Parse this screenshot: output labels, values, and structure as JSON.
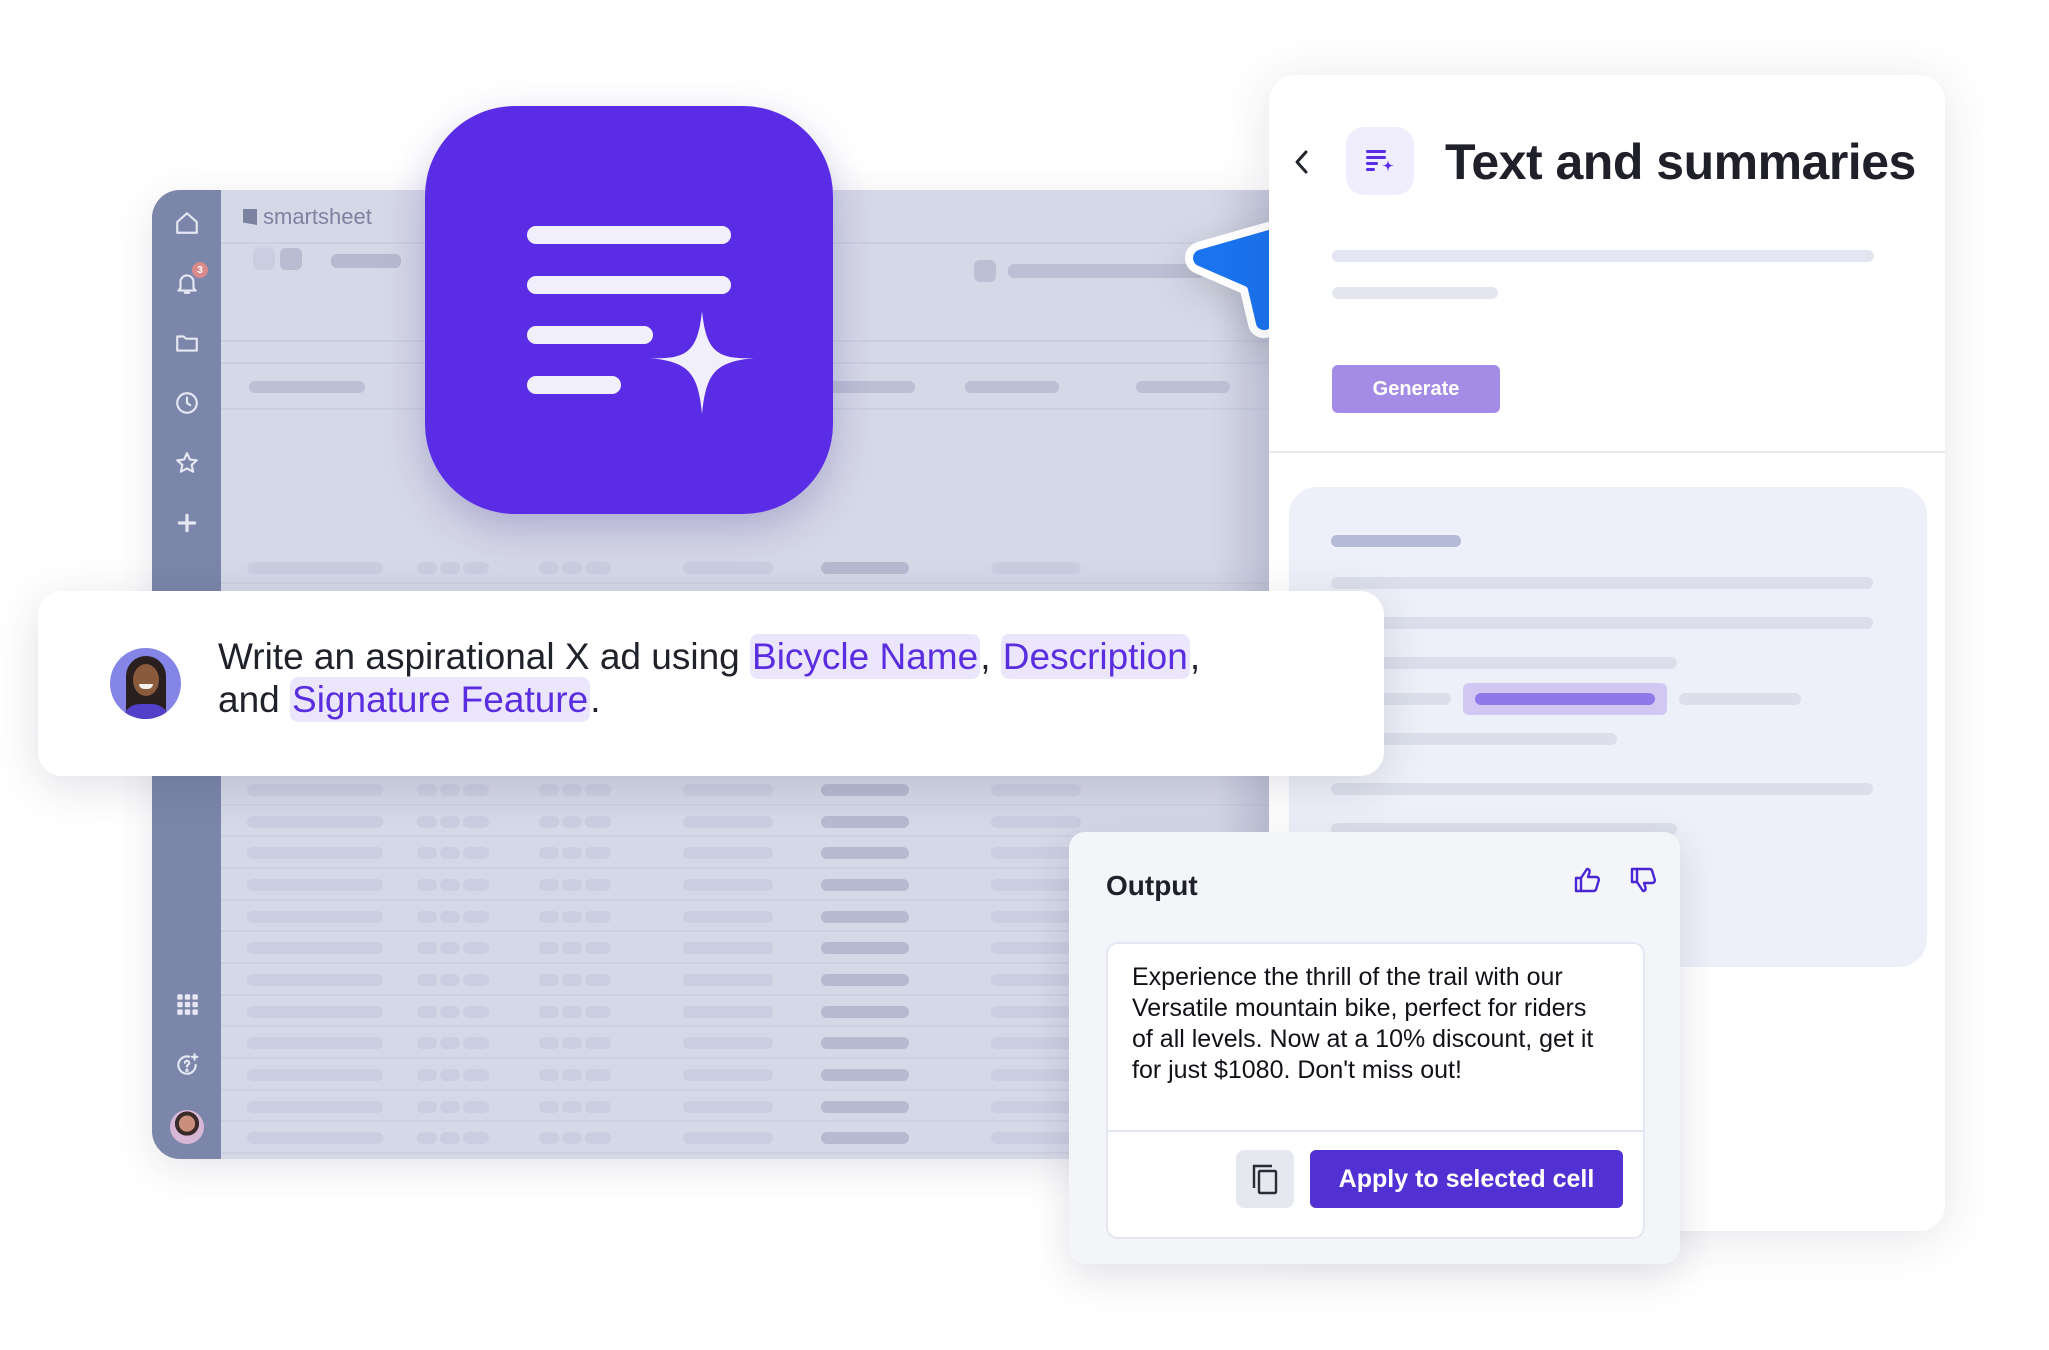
{
  "spreadsheet": {
    "logo_text": "smartsheet",
    "notification_count": "3",
    "sidebar_icons": [
      "home-icon",
      "bell-icon",
      "folder-icon",
      "clock-icon",
      "star-icon",
      "plus-icon",
      "apps-grid-icon",
      "help-sparkle-icon",
      "user-avatar"
    ]
  },
  "feature_icon": {
    "name": "text-summaries-icon",
    "color": "#5b2ce6"
  },
  "panel": {
    "title": "Text and summaries",
    "back_label": "Back",
    "generate_label": "Generate",
    "accent_color": "#a48ce6"
  },
  "prompt": {
    "text_before": "Write an aspirational X ad using ",
    "chips": [
      "Bicycle Name",
      "Description",
      "Signature Feature"
    ],
    "sep1": ", ",
    "sep2": ",",
    "sep3_prefix": "and ",
    "text_after": ".",
    "chip_color": "#5a2ee0"
  },
  "output": {
    "title": "Output",
    "thumbs_up_label": "Thumbs up",
    "thumbs_down_label": "Thumbs down",
    "text": "Experience the thrill of the trail with our Versatile mountain bike, perfect for riders of all levels. Now at a 10% discount, get it for just $1080. Don't miss out!",
    "copy_label": "Copy",
    "apply_label": "Apply to selected cell",
    "apply_color": "#5231d4"
  }
}
